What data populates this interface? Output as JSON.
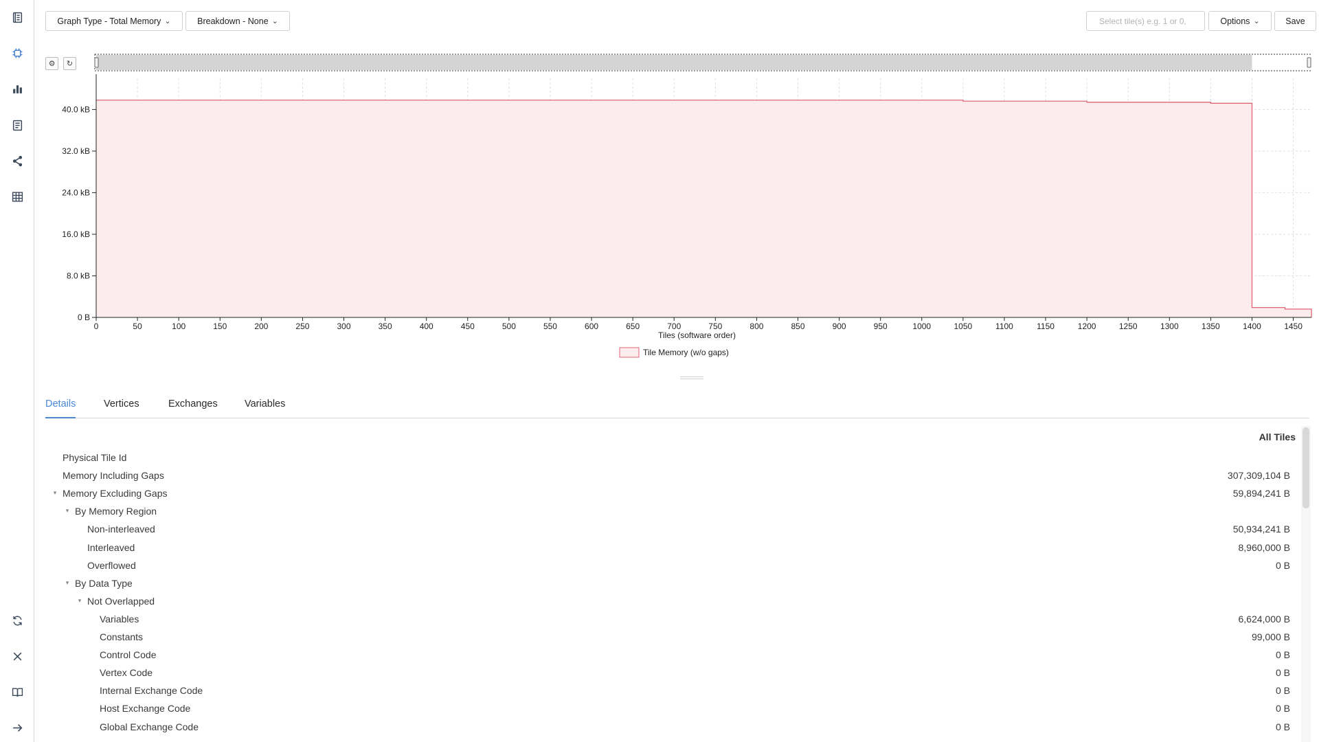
{
  "colors": {
    "accent": "#4a86d4",
    "series_stroke": "#e06472",
    "series_fill": "#fdeced",
    "rail_icon": "#3c4a5c",
    "rail_active": "#4a86d4"
  },
  "rail": {
    "top": [
      {
        "name": "report-icon",
        "active": false
      },
      {
        "name": "chip-icon",
        "active": true
      },
      {
        "name": "bar-chart-icon",
        "active": false
      },
      {
        "name": "document-icon",
        "active": false
      },
      {
        "name": "share-icon",
        "active": false
      },
      {
        "name": "table-icon",
        "active": false
      }
    ],
    "bottom": [
      {
        "name": "refresh-icon"
      },
      {
        "name": "close-icon"
      },
      {
        "name": "book-icon"
      },
      {
        "name": "arrow-right-icon"
      }
    ]
  },
  "toolbar": {
    "graph_type": "Graph Type - Total Memory",
    "breakdown": "Breakdown - None",
    "tile_placeholder": "Select tile(s) e.g. 1 or 0,",
    "options": "Options",
    "save": "Save"
  },
  "chart_data": {
    "type": "area",
    "title": "",
    "xlabel": "Tiles  (software order)",
    "ylabel": "",
    "xlim": [
      0,
      1472
    ],
    "ylim": [
      0,
      46
    ],
    "y_unit": "kB",
    "x_ticks": [
      0,
      50,
      100,
      150,
      200,
      250,
      300,
      350,
      400,
      450,
      500,
      550,
      600,
      650,
      700,
      750,
      800,
      850,
      900,
      950,
      1000,
      1050,
      1100,
      1150,
      1200,
      1250,
      1300,
      1350,
      1400,
      1450
    ],
    "y_ticks": [
      "0 B",
      "8.0 kB",
      "16.0 kB",
      "24.0 kB",
      "32.0 kB",
      "40.0 kB"
    ],
    "y_tick_values": [
      0,
      8,
      16,
      24,
      32,
      40
    ],
    "grid": true,
    "legend": "bottom-center",
    "series": [
      {
        "name": "Tile Memory (w/o gaps)",
        "x": [
          0,
          1050,
          1050,
          1200,
          1200,
          1350,
          1350,
          1400,
          1400,
          1440,
          1440,
          1472
        ],
        "values": [
          41.8,
          41.8,
          41.6,
          41.6,
          41.4,
          41.4,
          41.2,
          41.2,
          1.9,
          1.9,
          1.6,
          1.6
        ]
      }
    ]
  },
  "tabs": [
    {
      "label": "Details",
      "active": true
    },
    {
      "label": "Vertices",
      "active": false
    },
    {
      "label": "Exchanges",
      "active": false
    },
    {
      "label": "Variables",
      "active": false
    }
  ],
  "details": {
    "column_header": "All Tiles",
    "rows": [
      {
        "label": "Physical Tile Id",
        "value": "",
        "indent": 0,
        "caret": false
      },
      {
        "label": "Memory Including Gaps",
        "value": "307,309,104 B",
        "indent": 0,
        "caret": false
      },
      {
        "label": "Memory Excluding Gaps",
        "value": "59,894,241 B",
        "indent": 0,
        "caret": true
      },
      {
        "label": "By Memory Region",
        "value": "",
        "indent": 1,
        "caret": true
      },
      {
        "label": "Non-interleaved",
        "value": "50,934,241 B",
        "indent": 2,
        "caret": false
      },
      {
        "label": "Interleaved",
        "value": "8,960,000 B",
        "indent": 2,
        "caret": false
      },
      {
        "label": "Overflowed",
        "value": "0 B",
        "indent": 2,
        "caret": false
      },
      {
        "label": "By Data Type",
        "value": "",
        "indent": 1,
        "caret": true
      },
      {
        "label": "Not Overlapped",
        "value": "",
        "indent": 2,
        "caret": true
      },
      {
        "label": "Variables",
        "value": "6,624,000 B",
        "indent": 3,
        "caret": false
      },
      {
        "label": "Constants",
        "value": "99,000 B",
        "indent": 3,
        "caret": false
      },
      {
        "label": "Control Code",
        "value": "0 B",
        "indent": 3,
        "caret": false
      },
      {
        "label": "Vertex Code",
        "value": "0 B",
        "indent": 3,
        "caret": false
      },
      {
        "label": "Internal Exchange Code",
        "value": "0 B",
        "indent": 3,
        "caret": false
      },
      {
        "label": "Host Exchange Code",
        "value": "0 B",
        "indent": 3,
        "caret": false
      },
      {
        "label": "Global Exchange Code",
        "value": "0 B",
        "indent": 3,
        "caret": false
      }
    ]
  }
}
